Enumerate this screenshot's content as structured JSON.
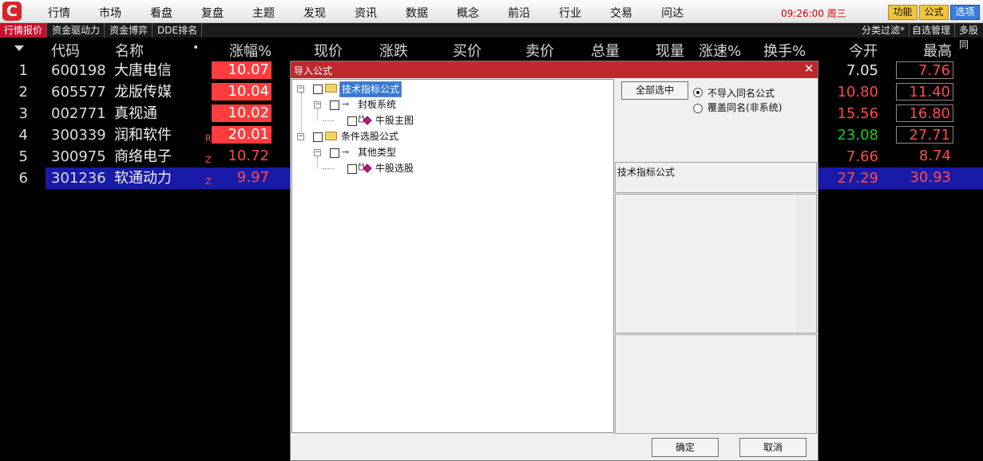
{
  "app": {
    "logo_glyph": "C"
  },
  "menu": [
    "行情",
    "市场",
    "看盘",
    "复盘",
    "主题",
    "发现",
    "资讯",
    "数据",
    "概念",
    "前沿",
    "行业",
    "交易",
    "问达"
  ],
  "clock": "09:26:00 周三",
  "top_buttons": [
    "功能",
    "公式",
    "选项"
  ],
  "sub_tabs_left": [
    "行情报价",
    "资金驱动力",
    "资金博弈",
    "DDE排名"
  ],
  "sub_tabs_right": [
    "分类过滤*",
    "自选管理",
    "多股同"
  ],
  "table": {
    "headers": {
      "code": "代码",
      "name": "名称",
      "change_pct": "涨幅%",
      "price": "现价",
      "change": "涨跌",
      "bid": "买价",
      "ask": "卖价",
      "volume": "总量",
      "cur_vol": "现量",
      "speed": "涨速%",
      "turnover": "换手%",
      "open": "今开",
      "high": "最高"
    },
    "rows": [
      {
        "idx": "1",
        "code": "600198",
        "name": "大唐电信",
        "flag": "",
        "change_pct": "10.07",
        "open": "7.05",
        "open_color": "#e8e8e8",
        "high": "7.76"
      },
      {
        "idx": "2",
        "code": "605577",
        "name": "龙版传媒",
        "flag": "",
        "change_pct": "10.04",
        "open": "10.80",
        "open_color": "#ff4a4a",
        "high": "11.40"
      },
      {
        "idx": "3",
        "code": "002771",
        "name": "真视通",
        "flag": "",
        "change_pct": "10.02",
        "open": "15.56",
        "open_color": "#ff4a4a",
        "high": "16.80"
      },
      {
        "idx": "4",
        "code": "300339",
        "name": "润和软件",
        "flag": "R",
        "change_pct": "20.01",
        "open": "23.08",
        "open_color": "#1ec81e",
        "high": "27.71"
      },
      {
        "idx": "5",
        "code": "300975",
        "name": "商络电子",
        "flag": "Z",
        "change_pct": "10.72",
        "open": "7.66",
        "open_color": "#ff4a4a",
        "high": "8.74"
      },
      {
        "idx": "6",
        "code": "301236",
        "name": "软通动力",
        "flag": "Z",
        "change_pct": "9.97",
        "open": "27.29",
        "open_color": "#ff4a4a",
        "high": "30.93"
      }
    ]
  },
  "dialog": {
    "title": "导入公式",
    "close_glyph": "✕",
    "tree": {
      "group1": "技术指标公式",
      "group1_child": "封板系统",
      "group1_leaf": "牛股主图",
      "group2": "条件选股公式",
      "group2_child": "其他类型",
      "group2_leaf": "牛股选股"
    },
    "select_all": "全部选中",
    "radio_no_import": "不导入同名公式",
    "radio_overwrite": "覆盖同名(非系统)",
    "description": "技术指标公式",
    "ok": "确定",
    "cancel": "取消"
  },
  "colors": {
    "up": "#ff4a4a",
    "down": "#1ec81e",
    "selected_row": "#1a1aa8",
    "dialog_title": "#c0282f"
  }
}
